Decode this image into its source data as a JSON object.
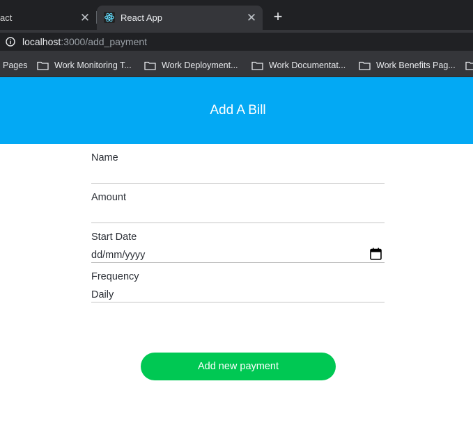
{
  "browser": {
    "tabs": [
      {
        "title": "act",
        "active": false
      },
      {
        "title": "React App",
        "active": true
      }
    ],
    "new_tab_label": "+",
    "close_glyph": "✕",
    "url_host": "localhost",
    "url_path": ":3000/add_payment",
    "bookmarks": [
      {
        "label": "Pages",
        "icon": "none"
      },
      {
        "label": "Work Monitoring T...",
        "icon": "folder-icon"
      },
      {
        "label": "Work Deployment...",
        "icon": "folder-icon"
      },
      {
        "label": "Work Documentat...",
        "icon": "folder-icon"
      },
      {
        "label": "Work Benefits Pag...",
        "icon": "folder-icon"
      },
      {
        "label": "",
        "icon": "folder-icon"
      }
    ]
  },
  "app": {
    "title": "Add A Bill",
    "header_color": "#03a9f4",
    "fields": {
      "name": {
        "label": "Name",
        "value": ""
      },
      "amount": {
        "label": "Amount",
        "value": ""
      },
      "start_date": {
        "label": "Start Date",
        "placeholder": "dd/mm/yyyy"
      },
      "frequency": {
        "label": "Frequency",
        "value": "Daily"
      }
    },
    "submit_label": "Add new payment",
    "submit_color": "#00c853"
  }
}
